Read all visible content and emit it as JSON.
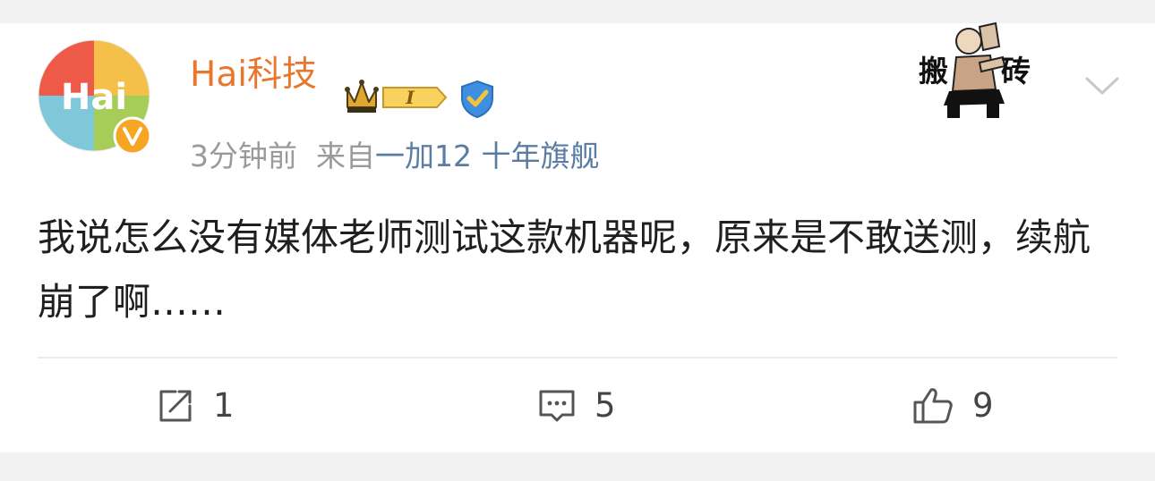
{
  "post": {
    "username": "Hai科技",
    "avatar_text": "Hai",
    "badge_level": "I",
    "time": "3分钟前",
    "source_prefix": "来自",
    "device": "一加12 十年旗舰",
    "text": "我说怎么没有媒体老师测试这款机器呢，原来是不敢送测，续航崩了啊……",
    "sticker_left": "搬",
    "sticker_right": "砖"
  },
  "actions": {
    "repost_count": "1",
    "comment_count": "5",
    "like_count": "9"
  },
  "colors": {
    "username": "#e8772e",
    "device": "#5b7da3",
    "meta": "#9a9a9a"
  },
  "icons": [
    "crown-badge-icon",
    "verified-v-icon",
    "blue-shield-icon",
    "chevron-down-icon",
    "repost-icon",
    "comment-icon",
    "like-icon"
  ]
}
